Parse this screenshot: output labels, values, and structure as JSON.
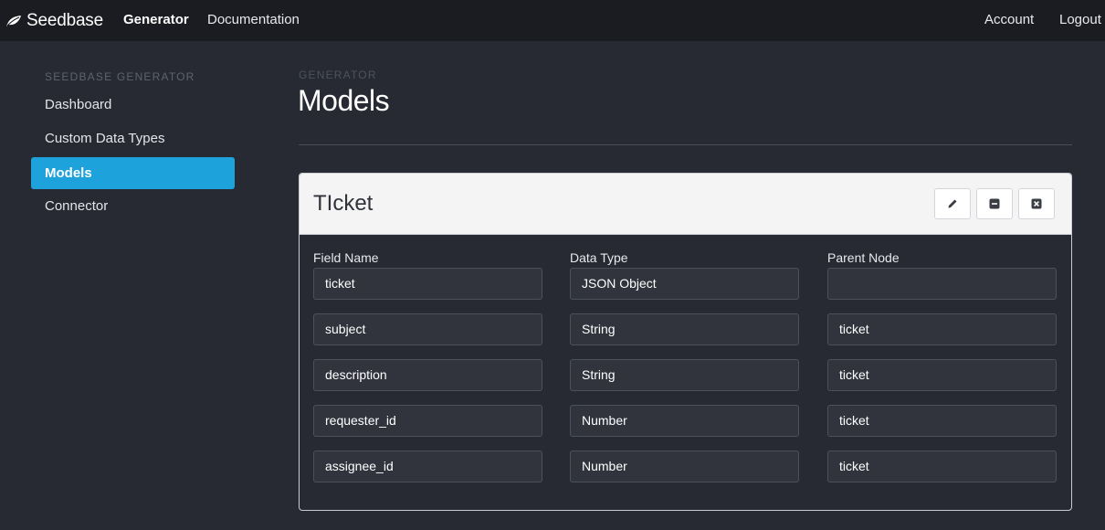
{
  "navbar": {
    "brand": "Seedbase",
    "links": {
      "generator": "Generator",
      "documentation": "Documentation"
    },
    "right": {
      "account": "Account",
      "logout": "Logout"
    }
  },
  "sidebar": {
    "heading": "SEEDBASE GENERATOR",
    "items": [
      {
        "label": "Dashboard",
        "active": false
      },
      {
        "label": "Custom Data Types",
        "active": false
      },
      {
        "label": "Models",
        "active": true
      },
      {
        "label": "Connector",
        "active": false
      }
    ]
  },
  "header": {
    "eyebrow": "GENERATOR",
    "title": "Models"
  },
  "model": {
    "name": "TIcket",
    "columns": {
      "field_name": "Field Name",
      "data_type": "Data Type",
      "parent_node": "Parent Node"
    },
    "rows": [
      {
        "field": "ticket",
        "type": "JSON Object",
        "parent": ""
      },
      {
        "field": "subject",
        "type": "String",
        "parent": "ticket"
      },
      {
        "field": "description",
        "type": "String",
        "parent": "ticket"
      },
      {
        "field": "requester_id",
        "type": "Number",
        "parent": "ticket"
      },
      {
        "field": "assignee_id",
        "type": "Number",
        "parent": "ticket"
      }
    ],
    "actions": [
      "pencil-icon",
      "minus-icon",
      "close-icon"
    ]
  },
  "colors": {
    "accent": "#1ea2dc",
    "navbar": "#1b1c21",
    "background": "#272a33"
  }
}
